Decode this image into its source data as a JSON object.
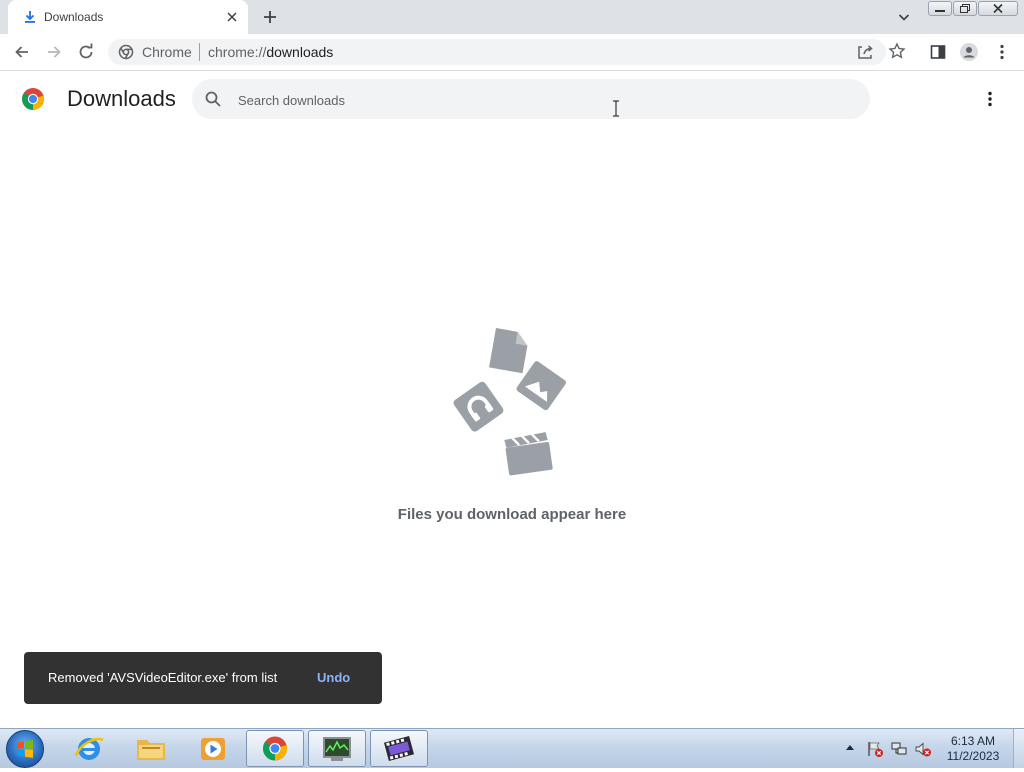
{
  "tab": {
    "title": "Downloads",
    "favicon": "download-icon"
  },
  "toolbar": {
    "omnibox_chip": "Chrome",
    "omnibox_scheme": "chrome://",
    "omnibox_host": "downloads"
  },
  "page": {
    "title": "Downloads",
    "search_placeholder": "Search downloads",
    "empty_message": "Files you download appear here"
  },
  "toast": {
    "message": "Removed 'AVSVideoEditor.exe' from list",
    "action": "Undo"
  },
  "taskbar": {
    "apps": [
      "internet-explorer-icon",
      "windows-explorer-icon",
      "media-player-icon",
      "chrome-icon",
      "task-manager-icon",
      "video-editor-icon"
    ],
    "clock_time": "6:13 AM",
    "clock_date": "11/2/2023"
  },
  "colors": {
    "accent_blue": "#1a73e8",
    "toast_bg": "#323232",
    "toast_action": "#8ab4f8",
    "tabstrip_bg": "#dee1e6"
  }
}
